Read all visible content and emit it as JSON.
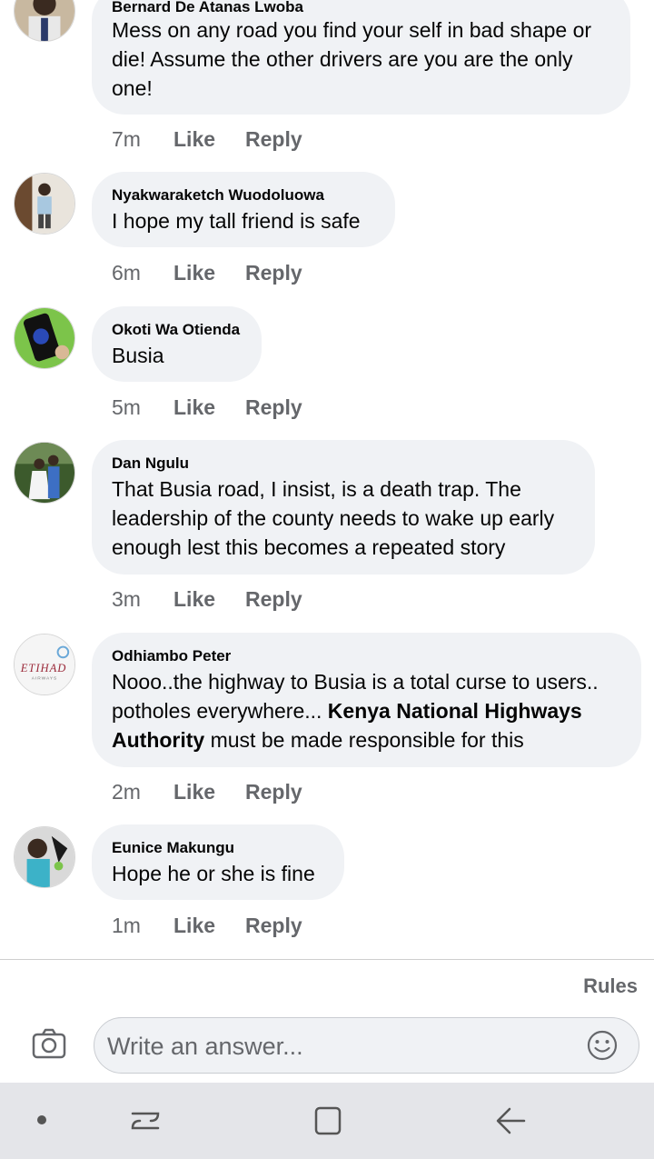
{
  "comments": [
    {
      "author": "Bernard De Atanas Lwoba",
      "lines": [
        "Mess on any road you find your self in bad shape or",
        "die! Assume the other drivers are you are the only",
        "one!"
      ],
      "time": "7m",
      "like": "Like",
      "reply": "Reply"
    },
    {
      "author": "Nyakwaraketch Wuodoluowa",
      "lines": [
        "I hope my tall friend is safe"
      ],
      "time": "6m",
      "like": "Like",
      "reply": "Reply"
    },
    {
      "author": "Okoti Wa Otienda",
      "lines": [
        "Busia"
      ],
      "time": "5m",
      "like": "Like",
      "reply": "Reply"
    },
    {
      "author": "Dan Ngulu",
      "lines": [
        "That Busia road, I insist, is a death trap. The",
        "leadership of the county needs to wake up early",
        "enough lest this becomes a repeated story"
      ],
      "time": "3m",
      "like": "Like",
      "reply": "Reply"
    },
    {
      "author": "Odhiambo Peter",
      "line1": "Nooo..the highway to Busia is a total curse to users..",
      "line2_pre": "potholes everywhere... ",
      "mention_part1": "Kenya National Highways",
      "mention_part2": "Authority",
      "line3_post": " must be made responsible for this",
      "avatar_text": "ETIHAD",
      "avatar_subtext": "AIRWAYS",
      "time": "2m",
      "like": "Like",
      "reply": "Reply"
    },
    {
      "author": "Eunice Makungu",
      "lines": [
        "Hope he or she is fine"
      ],
      "time": "1m",
      "like": "Like",
      "reply": "Reply"
    }
  ],
  "composer": {
    "rules_label": "Rules",
    "placeholder": "Write an answer...",
    "camera_icon": "camera-icon",
    "emoji_icon": "emoji-icon"
  },
  "nav": {
    "icons": [
      "dot-icon",
      "recent-apps-icon",
      "home-icon",
      "back-icon"
    ]
  },
  "colors": {
    "bubble": "#f0f2f5",
    "meta_text": "#65676b",
    "nav_background": "#e4e5e9"
  }
}
